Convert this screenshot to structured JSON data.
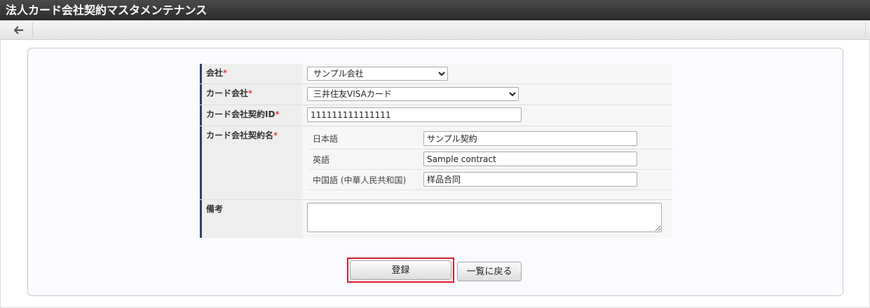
{
  "window": {
    "title": "法人カード会社契約マスタメンテナンス"
  },
  "toolbar": {
    "back_icon": "arrow-left-icon",
    "back_glyph": "🡐"
  },
  "form": {
    "company": {
      "label": "会社",
      "required_mark": "*",
      "value": "サンプル会社"
    },
    "card_company": {
      "label": "カード会社",
      "required_mark": "*",
      "value": "三井住友VISAカード"
    },
    "contract_id": {
      "label": "カード会社契約ID",
      "required_mark": "*",
      "value": "111111111111111"
    },
    "contract_name": {
      "label": "カード会社契約名",
      "required_mark": "*",
      "languages": [
        {
          "label": "日本語",
          "value": "サンプル契約"
        },
        {
          "label": "英語",
          "value": "Sample contract"
        },
        {
          "label": "中国語 (中華人民共和国)",
          "value": "样品合同"
        }
      ]
    },
    "remarks": {
      "label": "備考",
      "value": ""
    }
  },
  "actions": {
    "register_label": "登録",
    "back_to_list_label": "一覧に戻る",
    "highlight_color": "#d8202a"
  }
}
